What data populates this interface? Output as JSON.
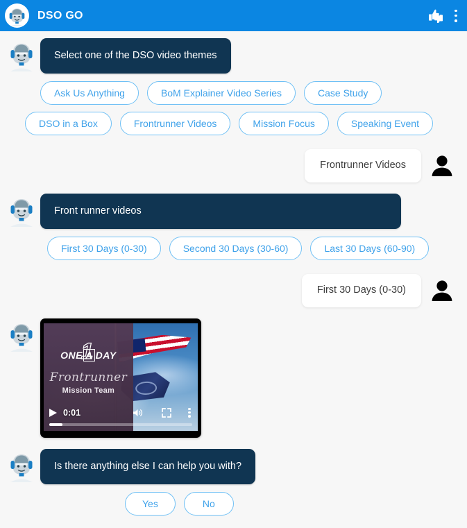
{
  "header": {
    "title": "DSO GO",
    "avatar_icon": "bot-avatar-icon",
    "feedback_icon": "thumbs-up-down-icon",
    "menu_icon": "more-vertical-icon"
  },
  "conversation": [
    {
      "role": "bot",
      "text": "Select one of the DSO video themes",
      "chips_row1": [
        "Ask Us Anything",
        "BoM Explainer Video Series",
        "Case Study"
      ],
      "chips_row2": [
        "DSO in a Box",
        "Frontrunner Videos",
        "Mission Focus",
        "Speaking Event"
      ]
    },
    {
      "role": "user",
      "text": "Frontrunner Videos"
    },
    {
      "role": "bot",
      "text": "Front runner videos",
      "chips_row1": [
        "First 30 Days (0-30)",
        "Second 30 Days (30-60)",
        "Last 30 Days (60-90)"
      ]
    },
    {
      "role": "user",
      "text": "First 30 Days (0-30)"
    },
    {
      "role": "bot_video"
    },
    {
      "role": "bot",
      "text": "Is there anything else I can help you with?",
      "chips_row1": [
        "Yes",
        "No"
      ]
    }
  ],
  "messages": {
    "bot_1": "Select one of the DSO video themes",
    "user_1": "Frontrunner Videos",
    "bot_2": "Front runner videos",
    "user_2": "First 30 Days (0-30)",
    "bot_3": "Is there anything else I can help you with?"
  },
  "chips": {
    "themes_row1": [
      "Ask Us Anything",
      "BoM Explainer Video Series",
      "Case Study"
    ],
    "themes_row2": [
      "DSO in a Box",
      "Frontrunner Videos",
      "Mission Focus",
      "Speaking Event"
    ],
    "days": [
      "First 30 Days (0-30)",
      "Second 30 Days (30-60)",
      "Last 30 Days (60-90)"
    ],
    "yes_no": [
      "Yes",
      "No"
    ]
  },
  "video": {
    "brand_one": "ONE",
    "brand_a": "A",
    "brand_day": "DAY",
    "brand_number": "1",
    "title": "Frontrunner",
    "subtitle": "Mission Team",
    "current_time": "0:01",
    "play_icon": "play-icon",
    "volume_icon": "volume-on-icon",
    "fullscreen_icon": "fullscreen-icon",
    "menu_icon": "more-vertical-icon",
    "progress_percent": 9
  },
  "colors": {
    "header_blue": "#0b86e2",
    "bot_bubble_navy": "#103552",
    "chip_border": "#6fc0f5",
    "chip_text": "#3fa2ea",
    "user_bubble": "#ffffff",
    "page_background": "#f7f7f7"
  }
}
